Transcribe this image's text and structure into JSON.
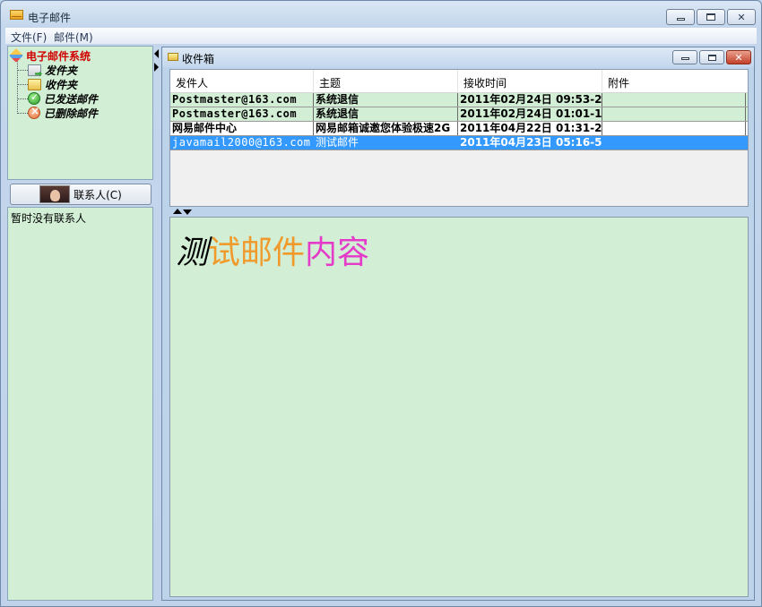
{
  "window": {
    "title": "电子邮件",
    "min_symbol": "",
    "max_symbol": "",
    "close_symbol": "✕"
  },
  "menu": [
    {
      "label": "文件(F)"
    },
    {
      "label": "邮件(M)"
    }
  ],
  "tree": {
    "root": "电子邮件系统",
    "items": [
      {
        "label": "发件夹",
        "icon": "send-folder-icon"
      },
      {
        "label": "收件夹",
        "icon": "folder-icon"
      },
      {
        "label": "已发送邮件",
        "icon": "check-icon"
      },
      {
        "label": "已删除邮件",
        "icon": "delete-icon"
      }
    ]
  },
  "contacts": {
    "button_label": "联系人(C)",
    "empty_text": "暂时没有联系人"
  },
  "inbox": {
    "title": "收件箱",
    "columns": [
      "发件人",
      "主题",
      "接收时间",
      "附件"
    ],
    "rows": [
      {
        "sender": "Postmaster@163.com",
        "subject": "系统退信",
        "time": "2011年02月24日 09:53-23",
        "attachment": ""
      },
      {
        "sender": "Postmaster@163.com",
        "subject": "系统退信",
        "time": "2011年02月24日 01:01-15",
        "attachment": ""
      },
      {
        "sender": "网易邮件中心",
        "subject": "网易邮箱诚邀您体验极速2G",
        "time": "2011年04月22日 01:31-22",
        "attachment": ""
      },
      {
        "sender": "javamail2000@163.com",
        "subject": "测试邮件",
        "time": "2011年04月23日 05:16-56",
        "attachment": ""
      }
    ],
    "selected_row": 3
  },
  "preview": {
    "part1": "测",
    "part2": "试邮件",
    "part3": "内容"
  },
  "colors": {
    "pane_green": "#d2efd6",
    "selection_blue": "#3399ff",
    "tree_root_red": "#d10000",
    "preview_orange": "#f09a2c",
    "preview_magenta": "#e43cc9"
  }
}
